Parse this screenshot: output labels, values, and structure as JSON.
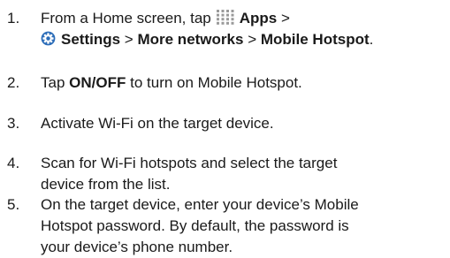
{
  "steps": [
    {
      "number": "1.",
      "part1": "From a Home screen, tap",
      "apps_label": "Apps",
      "sep1": ">",
      "settings_label": "Settings",
      "sep2": ">",
      "more_networks_label": "More networks",
      "sep3": ">",
      "mobile_hotspot_label": "Mobile Hotspot",
      "end": "."
    },
    {
      "number": "2.",
      "part1": "Tap",
      "onoff_label": "ON/OFF",
      "part2": "to turn on Mobile Hotspot."
    },
    {
      "number": "3.",
      "line1": "Activate Wi-Fi on the target device."
    },
    {
      "number": "4.",
      "line1": "Scan for Wi-Fi hotspots and select the target",
      "line2": "device from the list."
    },
    {
      "number": "5.",
      "line1": "On the target device, enter your device’s Mobile",
      "line2": "Hotspot password. By default, the password is",
      "line3": "your device’s phone number."
    }
  ],
  "icons": {
    "apps": "apps-grid-icon",
    "settings": "settings-gear-icon"
  },
  "colors": {
    "text": "#1a1a1a",
    "settings_icon_blue": "#2b6cb8"
  }
}
